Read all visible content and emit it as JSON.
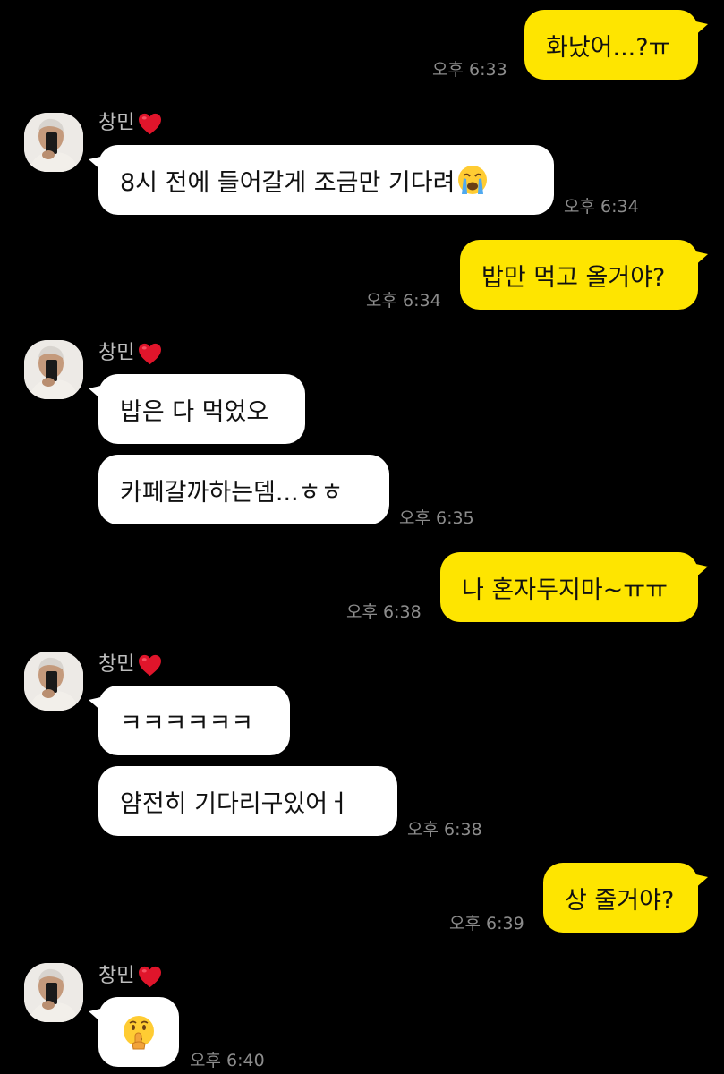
{
  "chat": {
    "contact_name": "창민",
    "messages": [
      {
        "text": "화났어...?ㅠ",
        "time": "오후 6:33"
      },
      {
        "text": "8시 전에 들어갈게 조금만 기다려",
        "emoji": "loudly-crying-face",
        "time": "오후 6:34"
      },
      {
        "text": "밥만 먹고 올거야?",
        "time": "오후 6:34"
      },
      {
        "text": "밥은 다 먹었오"
      },
      {
        "text": "카페갈까하는뎀...ㅎㅎ",
        "time": "오후 6:35"
      },
      {
        "text": "나 혼자두지마~ㅠㅠ",
        "time": "오후 6:38"
      },
      {
        "text": "ㅋㅋㅋㅋㅋㅋ"
      },
      {
        "text": "얌전히 기다리구있어ㅓ",
        "time": "오후 6:38"
      },
      {
        "text": "상 줄거야?",
        "time": "오후 6:39"
      },
      {
        "emoji": "shushing-face",
        "time": "오후 6:40"
      }
    ]
  },
  "colors": {
    "background": "#000000",
    "sent_bubble": "#FEE500",
    "received_bubble": "#FFFFFF",
    "timestamp": "#8C8C8C",
    "sender_name": "#BDBDBD",
    "heart": "#E0152B"
  },
  "icons": {
    "heart": "heart-icon",
    "cry_emoji": "loudly-crying-face-icon",
    "shush_emoji": "shushing-face-icon"
  }
}
